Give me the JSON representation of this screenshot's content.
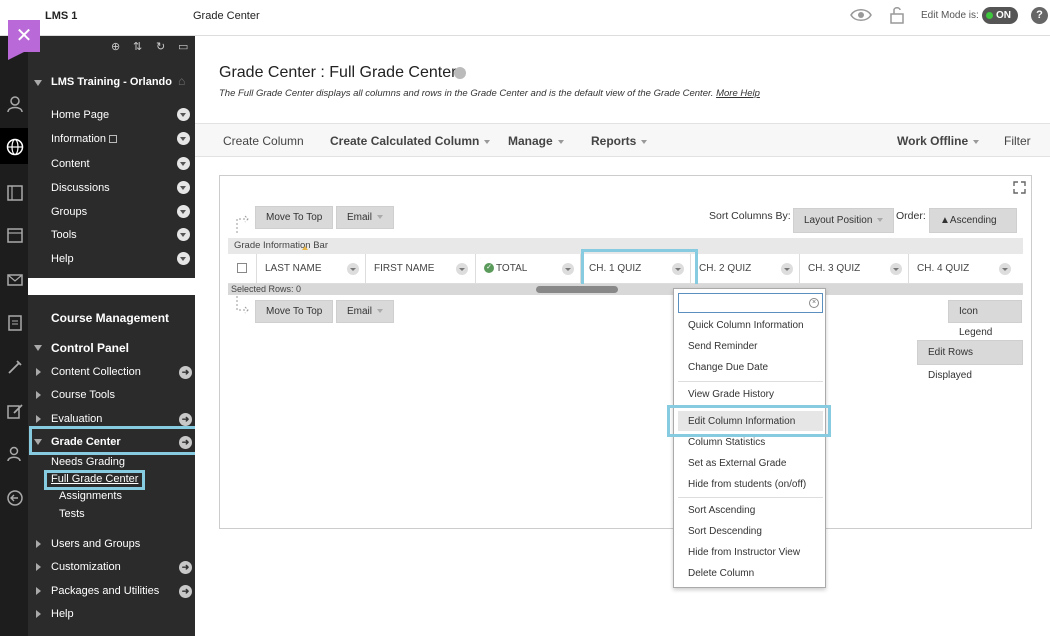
{
  "topbar": {
    "course": "LMS 1",
    "breadcrumb": "Grade Center",
    "edit_mode_label": "Edit Mode is:",
    "edit_mode_state": "ON",
    "help": "?"
  },
  "sidebar": {
    "close_glyph": "✕",
    "course_name": "LMS Training - Orlando",
    "menu": [
      "Home Page",
      "Information",
      "Content",
      "Discussions",
      "Groups",
      "Tools",
      "Help"
    ],
    "course_management": "Course Management",
    "control_panel": "Control Panel",
    "cp_items": [
      "Content Collection",
      "Course Tools",
      "Evaluation",
      "Grade Center"
    ],
    "grade_center_sub": [
      "Needs Grading",
      "Full Grade Center",
      "Assignments",
      "Tests"
    ],
    "bottom_items": [
      "Users and Groups",
      "Customization",
      "Packages and Utilities",
      "Help"
    ]
  },
  "main": {
    "title": "Grade Center : Full Grade Center",
    "description": "The Full Grade Center displays all columns and rows in the Grade Center and is the default view of the Grade Center.",
    "more_help": "More Help",
    "actions": {
      "create_column": "Create Column",
      "create_calculated_column": "Create Calculated Column",
      "manage": "Manage",
      "reports": "Reports",
      "work_offline": "Work Offline",
      "filter": "Filter"
    },
    "move_to_top": "Move To Top",
    "email": "Email",
    "sort_columns_by": "Sort Columns By:",
    "layout_position": "Layout Position",
    "order_label": "Order:",
    "order_value": "▲Ascending",
    "grade_info_bar": "Grade Information Bar",
    "columns": [
      "LAST NAME",
      "FIRST NAME",
      "TOTAL",
      "CH. 1 QUIZ",
      "CH. 2 QUIZ",
      "CH. 3 QUIZ",
      "CH. 4 QUIZ"
    ],
    "selected_rows": "Selected Rows: 0",
    "icon_legend": "Icon Legend",
    "edit_rows_displayed": "Edit Rows Displayed"
  },
  "context_menu": {
    "items": [
      "Quick Column Information",
      "Send Reminder",
      "Change Due Date",
      "View Grade History",
      "Edit Column Information",
      "Column Statistics",
      "Set as External Grade",
      "Hide from students (on/off)",
      "Sort Ascending",
      "Sort Descending",
      "Hide from Instructor View",
      "Delete Column"
    ]
  },
  "colors": {
    "accent_purple": "#b96ad8",
    "highlight_blue": "#86cbe0",
    "sidebar_bg": "#2b2b2b",
    "toggle_on": "#3ec63e"
  }
}
